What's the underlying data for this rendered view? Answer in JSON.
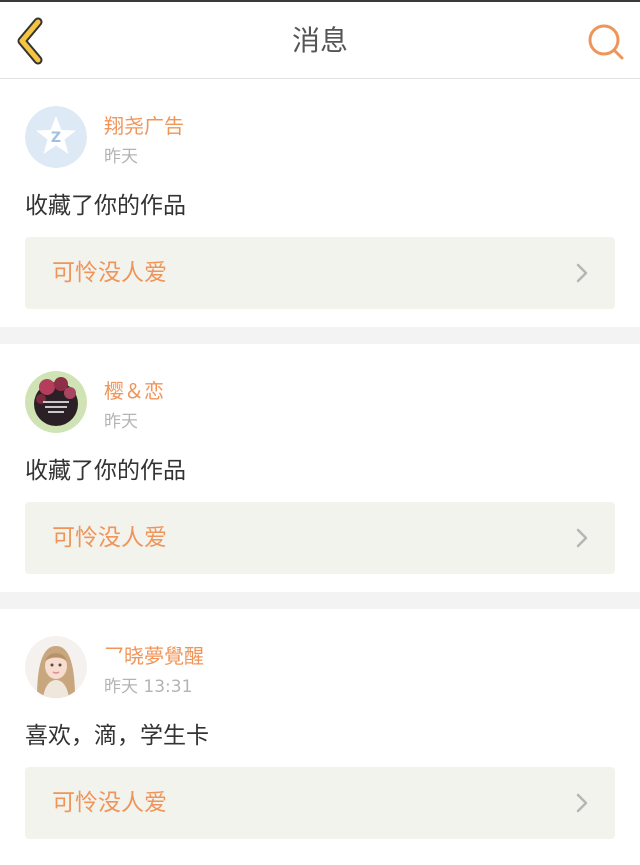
{
  "header": {
    "title": "消息",
    "back_icon": "chevron-left-icon",
    "search_icon": "search-icon"
  },
  "colors": {
    "accent": "#f0955a",
    "back_icon": "#f5c542",
    "page_bg": "#f3f3f3",
    "link_bg": "#f3f3ee"
  },
  "messages": [
    {
      "user": "翔尧广告",
      "time": "昨天",
      "avatar": "qzone-default-avatar",
      "text": "收藏了你的作品",
      "work_title": "可怜没人爱",
      "link_icon": "chevron-right-icon"
    },
    {
      "user": "樱＆恋",
      "time": "昨天",
      "avatar": "user-photo-avatar",
      "text": "收藏了你的作品",
      "work_title": "可怜没人爱",
      "link_icon": "chevron-right-icon"
    },
    {
      "user": "乛晓夢覺醒",
      "time": "昨天 13:31",
      "avatar": "user-photo-avatar",
      "text": "喜欢，滴，学生卡",
      "work_title": "可怜没人爱",
      "link_icon": "chevron-right-icon"
    }
  ]
}
